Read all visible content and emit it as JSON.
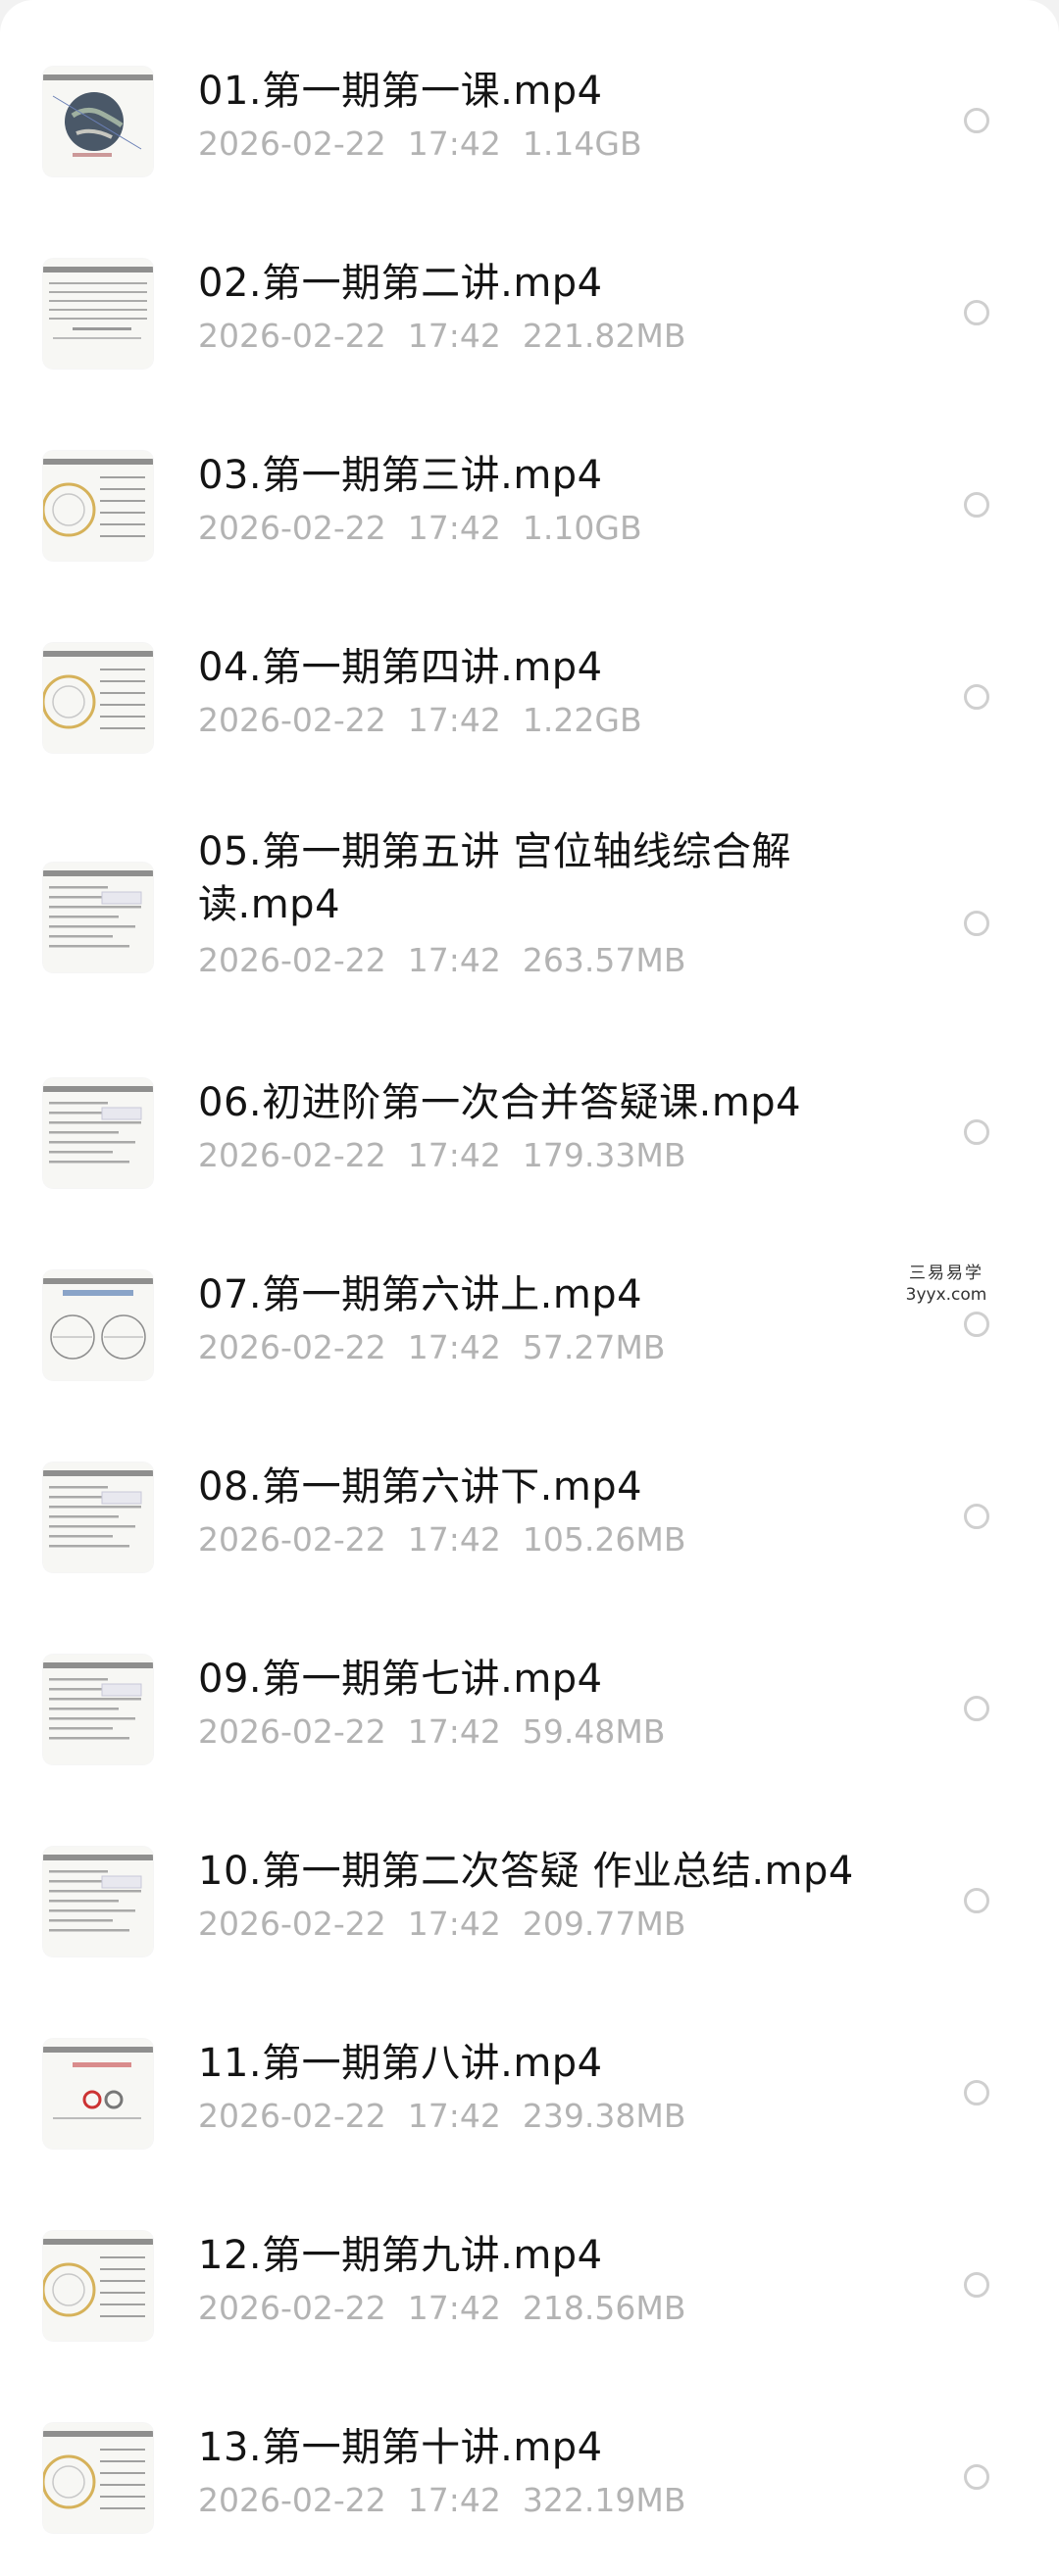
{
  "files": [
    {
      "name": "01.第一期第一课.mp4",
      "date": "2026-02-22",
      "time": "17:42",
      "size": "1.14GB",
      "thumbnail": "earth-globe-lecture-slide"
    },
    {
      "name": "02.第一期第二讲.mp4",
      "date": "2026-02-22",
      "time": "17:42",
      "size": "221.82MB",
      "thumbnail": "table-lecture-slide"
    },
    {
      "name": "03.第一期第三讲.mp4",
      "date": "2026-02-22",
      "time": "17:42",
      "size": "1.10GB",
      "thumbnail": "chart-wheel-lecture-slide"
    },
    {
      "name": "04.第一期第四讲.mp4",
      "date": "2026-02-22",
      "time": "17:42",
      "size": "1.22GB",
      "thumbnail": "chart-wheel-lecture-slide"
    },
    {
      "name": "05.第一期第五讲 宫位轴线综合解读.mp4",
      "date": "2026-02-22",
      "time": "17:42",
      "size": "263.57MB",
      "thumbnail": "text-lecture-slide"
    },
    {
      "name": "06.初进阶第一次合并答疑课.mp4",
      "date": "2026-02-22",
      "time": "17:42",
      "size": "179.33MB",
      "thumbnail": "text-lecture-slide"
    },
    {
      "name": "07.第一期第六讲上.mp4",
      "date": "2026-02-22",
      "time": "17:42",
      "size": "57.27MB",
      "thumbnail": "double-chart-wheel-slide"
    },
    {
      "name": "08.第一期第六讲下.mp4",
      "date": "2026-02-22",
      "time": "17:42",
      "size": "105.26MB",
      "thumbnail": "text-lecture-slide"
    },
    {
      "name": "09.第一期第七讲.mp4",
      "date": "2026-02-22",
      "time": "17:42",
      "size": "59.48MB",
      "thumbnail": "text-lecture-slide"
    },
    {
      "name": "10.第一期第二次答疑 作业总结.mp4",
      "date": "2026-02-22",
      "time": "17:42",
      "size": "209.77MB",
      "thumbnail": "text-lecture-slide"
    },
    {
      "name": "11.第一期第八讲.mp4",
      "date": "2026-02-22",
      "time": "17:42",
      "size": "239.38MB",
      "thumbnail": "diagram-lecture-slide"
    },
    {
      "name": "12.第一期第九讲.mp4",
      "date": "2026-02-22",
      "time": "17:42",
      "size": "218.56MB",
      "thumbnail": "chart-wheel-lecture-slide"
    },
    {
      "name": "13.第一期第十讲.mp4",
      "date": "2026-02-22",
      "time": "17:42",
      "size": "322.19MB",
      "thumbnail": "chart-wheel-lecture-slide"
    }
  ],
  "watermark": {
    "line1": "三易易学",
    "line2": "3yyx.com"
  },
  "colors": {
    "name_text": "#141414",
    "meta_text": "#b3b3b3",
    "circle_border": "#cfcfcf",
    "background": "#ffffff"
  }
}
